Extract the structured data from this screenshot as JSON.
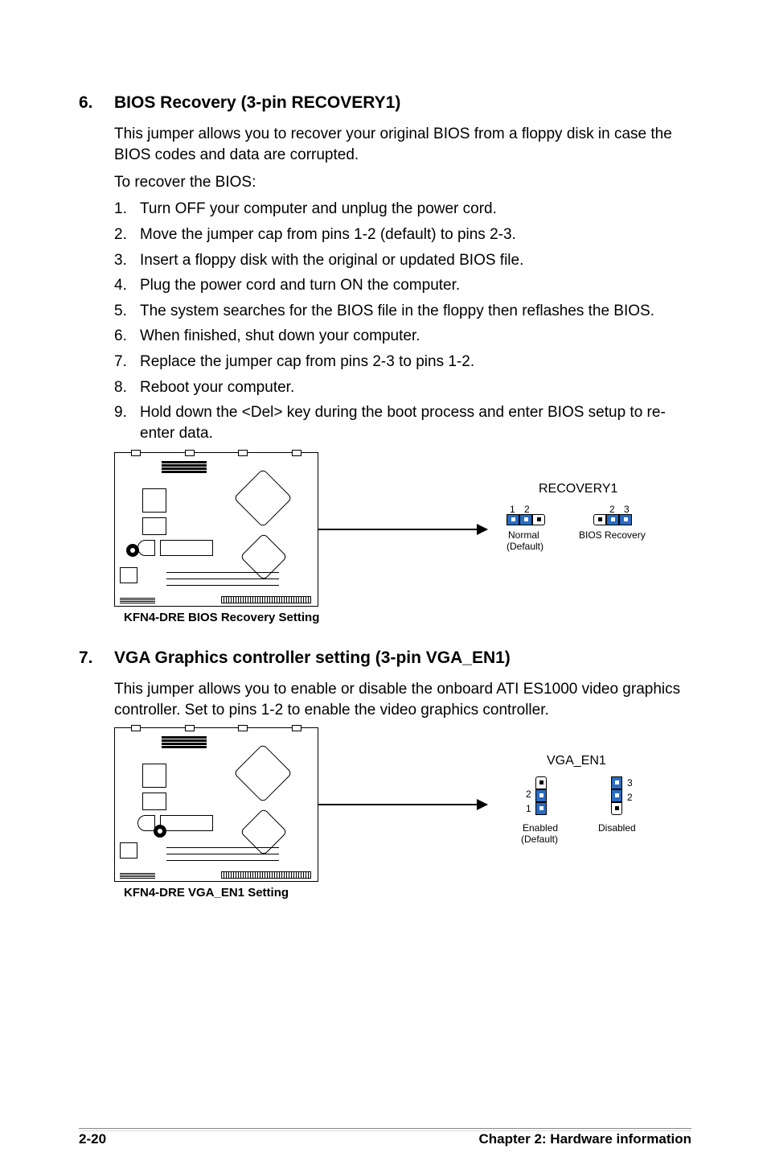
{
  "section6": {
    "num": "6.",
    "title": "BIOS Recovery (3-pin RECOVERY1)",
    "intro": "This jumper allows you to recover your original BIOS from a floppy disk in case the BIOS codes and data are corrupted.",
    "lead": "To recover the BIOS:",
    "steps": [
      "Turn OFF your computer and unplug the power cord.",
      "Move the jumper cap from pins 1-2 (default) to pins 2-3.",
      "Insert a floppy disk with the original or updated BIOS file.",
      "Plug the power cord and turn ON the computer.",
      "The system searches for the BIOS file in the floppy then reflashes the BIOS.",
      "When finished, shut down your computer.",
      "Replace the jumper cap from pins 2-3 to pins 1-2.",
      "Reboot your computer.",
      "Hold down the <Del> key during the boot process and enter BIOS setup to re-enter data."
    ],
    "diagram": {
      "header": "RECOVERY1",
      "left": {
        "n1": "1",
        "n2": "2",
        "label1": "Normal",
        "label2": "(Default)"
      },
      "right": {
        "n2": "2",
        "n3": "3",
        "label": "BIOS Recovery"
      }
    },
    "caption": "KFN4-DRE BIOS Recovery Setting"
  },
  "section7": {
    "num": "7.",
    "title": "VGA Graphics controller setting (3-pin VGA_EN1)",
    "intro": "This jumper allows you to enable or disable the onboard ATI ES1000 video graphics controller. Set to pins 1-2 to enable the video graphics controller.",
    "diagram": {
      "header": "VGA_EN1",
      "left": {
        "n1": "1",
        "n2": "2",
        "label1": "Enabled",
        "label2": "(Default)"
      },
      "right": {
        "n2": "2",
        "n3": "3",
        "label": "Disabled"
      }
    },
    "caption": "KFN4-DRE VGA_EN1 Setting"
  },
  "footer": {
    "page": "2-20",
    "chapter": "Chapter 2: Hardware information"
  }
}
